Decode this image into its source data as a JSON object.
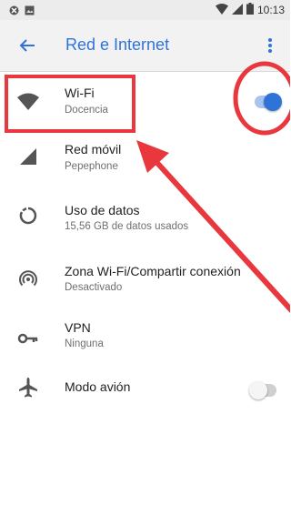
{
  "status_bar": {
    "time": "10:13"
  },
  "app_bar": {
    "title": "Red e Internet"
  },
  "settings": [
    {
      "label": "Wi-Fi",
      "subtitle": "Docencia",
      "icon": "wifi-icon",
      "toggle": "on"
    },
    {
      "label": "Red móvil",
      "subtitle": "Pepephone",
      "icon": "cellular-signal-icon"
    },
    {
      "label": "Uso de datos",
      "subtitle": "15,56 GB de datos usados",
      "icon": "data-usage-icon"
    },
    {
      "label": "Zona Wi-Fi/Compartir conexión",
      "subtitle": "Desactivado",
      "icon": "hotspot-icon"
    },
    {
      "label": "VPN",
      "subtitle": "Ninguna",
      "icon": "vpn-key-icon"
    },
    {
      "label": "Modo avión",
      "subtitle": "",
      "icon": "airplane-icon",
      "toggle": "off"
    }
  ],
  "colors": {
    "accent": "#2f73d9",
    "annotation": "#e8383d"
  }
}
